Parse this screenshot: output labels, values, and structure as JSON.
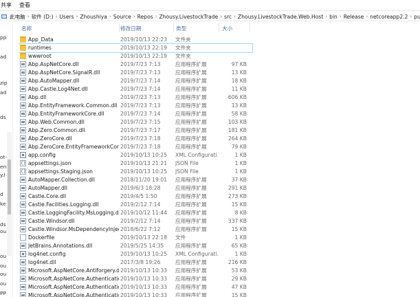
{
  "ribbon": {
    "share": "共享",
    "view": "查看"
  },
  "breadcrumb": [
    "此电脑",
    "软件 (D:)",
    "Users",
    "Zhoushiya",
    "Source",
    "Repos",
    "Zhousy.LivestockTrade",
    "src",
    "Zhousy.LivestockTrade.Web.Host",
    "bin",
    "Release",
    "netcoreapp2.2",
    "publish"
  ],
  "nav": [
    "pp",
    "ad",
    "zip",
    "ad",
    "ds",
    "ot-",
    "ent",
    "y.l",
    "d",
    "ke",
    "ds",
    "ou",
    "ou",
    "ou",
    "ou",
    "ou",
    "PP"
  ],
  "columns": {
    "name": "名称",
    "date": "修改日期",
    "type": "类型",
    "size": "大小"
  },
  "files": [
    {
      "name": "App_Data",
      "date": "2019/10/13 22:23",
      "type": "文件夹",
      "size": "",
      "icon": "folder-icon"
    },
    {
      "name": "runtimes",
      "date": "2019/10/13 22:19",
      "type": "文件夹",
      "size": "",
      "icon": "folder-icon"
    },
    {
      "name": "wwwroot",
      "date": "2019/10/13 22:19",
      "type": "文件夹",
      "size": "",
      "icon": "folder-icon"
    },
    {
      "name": "Abp.AspNetCore.dll",
      "date": "2019/7/23 7:13",
      "type": "应用程序扩展",
      "size": "97 KB",
      "icon": "dll-icon"
    },
    {
      "name": "Abp.AspNetCore.SignalR.dll",
      "date": "2019/7/23 7:13",
      "type": "应用程序扩展",
      "size": "13 KB",
      "icon": "dll-icon"
    },
    {
      "name": "Abp.AutoMapper.dll",
      "date": "2019/7/23 7:14",
      "type": "应用程序扩展",
      "size": "18 KB",
      "icon": "dll-icon"
    },
    {
      "name": "Abp.Castle.Log4Net.dll",
      "date": "2019/7/23 7:14",
      "type": "应用程序扩展",
      "size": "11 KB",
      "icon": "dll-icon"
    },
    {
      "name": "Abp.dll",
      "date": "2019/7/23 7:13",
      "type": "应用程序扩展",
      "size": "606 KB",
      "icon": "dll-icon"
    },
    {
      "name": "Abp.EntityFramework.Common.dll",
      "date": "2019/7/23 7:13",
      "type": "应用程序扩展",
      "size": "13 KB",
      "icon": "dll-icon"
    },
    {
      "name": "Abp.EntityFrameworkCore.dll",
      "date": "2019/7/23 7:14",
      "type": "应用程序扩展",
      "size": "58 KB",
      "icon": "dll-icon"
    },
    {
      "name": "Abp.Web.Common.dll",
      "date": "2019/7/23 7:15",
      "type": "应用程序扩展",
      "size": "103 KB",
      "icon": "dll-icon"
    },
    {
      "name": "Abp.Zero.Common.dll",
      "date": "2019/7/23 7:17",
      "type": "应用程序扩展",
      "size": "181 KB",
      "icon": "dll-icon"
    },
    {
      "name": "Abp.ZeroCore.dll",
      "date": "2019/7/23 7:18",
      "type": "应用程序扩展",
      "size": "264 KB",
      "icon": "dll-icon"
    },
    {
      "name": "Abp.ZeroCore.EntityFrameworkCore....",
      "date": "2019/7/23 7:18",
      "type": "应用程序扩展",
      "size": "79 KB",
      "icon": "dll-icon"
    },
    {
      "name": "app.config",
      "date": "2019/10/13 10:25",
      "type": "XML Configurati...",
      "size": "1 KB",
      "icon": "config-icon"
    },
    {
      "name": "appsettings.json",
      "date": "2019/10/13 21:21",
      "type": "JSON File",
      "size": "1 KB",
      "icon": "json-icon"
    },
    {
      "name": "appsettings.Staging.json",
      "date": "2019/10/13 10:25",
      "type": "JSON File",
      "size": "1 KB",
      "icon": "json-icon"
    },
    {
      "name": "AutoMapper.Collection.dll",
      "date": "2018/11/20 19:01",
      "type": "应用程序扩展",
      "size": "37 KB",
      "icon": "dll-icon"
    },
    {
      "name": "AutoMapper.dll",
      "date": "2019/6/3 18:28",
      "type": "应用程序扩展",
      "size": "291 KB",
      "icon": "dll-icon"
    },
    {
      "name": "Castle.Core.dll",
      "date": "2019/4/5 1:50",
      "type": "应用程序扩展",
      "size": "273 KB",
      "icon": "dll-icon"
    },
    {
      "name": "Castle.Facilities.Logging.dll",
      "date": "2019/2/12 7:14",
      "type": "应用程序扩展",
      "size": "15 KB",
      "icon": "dll-icon"
    },
    {
      "name": "Castle.LoggingFacility.MsLogging.dll",
      "date": "2019/10/12 11:44",
      "type": "应用程序扩展",
      "size": "8 KB",
      "icon": "dll-icon"
    },
    {
      "name": "Castle.Windsor.dll",
      "date": "2019/2/12 7:14",
      "type": "应用程序扩展",
      "size": "337 KB",
      "icon": "dll-icon"
    },
    {
      "name": "Castle.Windsor.MsDependencyInject...",
      "date": "2018/6/22 7:12",
      "type": "应用程序扩展",
      "size": "15 KB",
      "icon": "dll-icon"
    },
    {
      "name": "Dockerfile",
      "date": "2019/10/13 22:18",
      "type": "文件",
      "size": "1 KB",
      "icon": "file-icon"
    },
    {
      "name": "JetBrains.Annotations.dll",
      "date": "2019/5/25 14:35",
      "type": "应用程序扩展",
      "size": "65 KB",
      "icon": "dll-icon"
    },
    {
      "name": "log4net.config",
      "date": "2019/10/13 10:25",
      "type": "XML Configurati...",
      "size": "1 KB",
      "icon": "config-icon"
    },
    {
      "name": "log4net.dll",
      "date": "2017/3/8 19:26",
      "type": "应用程序扩展",
      "size": "216 KB",
      "icon": "dll-icon"
    },
    {
      "name": "Microsoft.AspNetCore.Antiforgery.dll",
      "date": "2019/10/13 10:33",
      "type": "应用程序扩展",
      "size": "53 KB",
      "icon": "dll-icon"
    },
    {
      "name": "Microsoft.AspNetCore.Authenticatio...",
      "date": "2019/10/13 10:33",
      "type": "应用程序扩展",
      "size": "29 KB",
      "icon": "dll-icon"
    },
    {
      "name": "Microsoft.AspNetCore.Authenticatio...",
      "date": "2019/10/13 10:33",
      "type": "应用程序扩展",
      "size": "47 KB",
      "icon": "dll-icon"
    },
    {
      "name": "Microsoft.AspNetCore.Authenticatio...",
      "date": "2019/10/13 10:33",
      "type": "应用程序扩展",
      "size": "15 KB",
      "icon": "dll-icon"
    }
  ],
  "highlighted_row": 1
}
